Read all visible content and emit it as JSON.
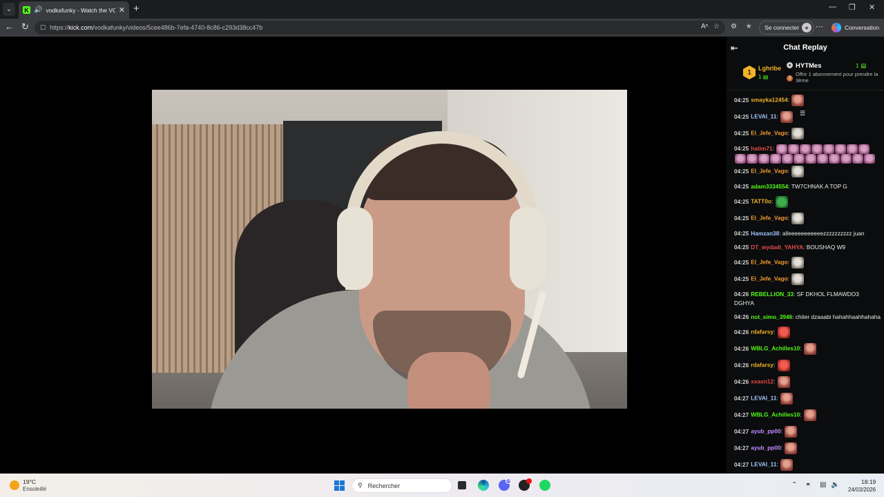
{
  "browser": {
    "tab_title": "vodkafunky - Watch the VOD",
    "url_prefix": "https://",
    "url_domain": "kick.com",
    "url_path": "/vodkafunky/videos/5cee486b-7efa-4740-8c86-c293d38cc47b",
    "sign_in_label": "Se connecter",
    "copilot_label": "Conversation"
  },
  "chat": {
    "title": "Chat Replay",
    "leader": {
      "rank": "1",
      "name": "Lghribe",
      "count": "1"
    },
    "gifter": {
      "name": "HYTMes",
      "count": "1",
      "third_rank": "3",
      "note": "Offrir 1 abonnement pour prendre la 3ème"
    },
    "messages": [
      {
        "time": "04:25",
        "user": "smayka12454",
        "color": "#f0b429",
        "text": "",
        "emotes": [
          "brown"
        ]
      },
      {
        "time": "04:25",
        "user": "LEVAI_11",
        "color": "#9ec7ff",
        "text": "",
        "emotes": [
          "brown"
        ]
      },
      {
        "time": "04:25",
        "user": "El_Jefe_Vago",
        "color": "#f39c33",
        "text": "",
        "emotes": [
          "gray"
        ]
      },
      {
        "time": "04:25",
        "user": "hatim71",
        "color": "#e64b4b",
        "text": "",
        "emotes": [
          "pink",
          "pink",
          "pink",
          "pink",
          "pink",
          "pink",
          "pink",
          "pink",
          "pink",
          "pink",
          "pink",
          "pink",
          "pink",
          "pink",
          "pink",
          "pink",
          "pink",
          "pink",
          "pink",
          "pink"
        ]
      },
      {
        "time": "04:25",
        "user": "El_Jefe_Vago",
        "color": "#f39c33",
        "text": "",
        "emotes": [
          "gray"
        ]
      },
      {
        "time": "04:25",
        "user": "adam3334554",
        "color": "#53fc18",
        "text": "TW7CHNAK A TOP G",
        "emotes": []
      },
      {
        "time": "04:25",
        "user": "TATT0o",
        "color": "#f0b429",
        "text": "",
        "emotes": [
          "frog"
        ]
      },
      {
        "time": "04:25",
        "user": "El_Jefe_Vago",
        "color": "#f39c33",
        "text": "",
        "emotes": [
          "gray"
        ]
      },
      {
        "time": "04:25",
        "user": "Hamzan38",
        "color": "#9ec7ff",
        "text": "alleeeeeeeeeeezzzzzzzzzz juan",
        "emotes": []
      },
      {
        "time": "04:25",
        "user": "DT_wydadi_YAHYA",
        "color": "#e64b4b",
        "text": "BOUSHAQ W9",
        "emotes": []
      },
      {
        "time": "04:25",
        "user": "El_Jefe_Vago",
        "color": "#f39c33",
        "text": "",
        "emotes": [
          "gray"
        ]
      },
      {
        "time": "04:25",
        "user": "El_Jefe_Vago",
        "color": "#f39c33",
        "text": "",
        "emotes": [
          "gray"
        ]
      },
      {
        "time": "04:26",
        "user": "REBELLION_33",
        "color": "#53fc18",
        "text": "SF DKHOL FLMAWDO3 DGHYA",
        "emotes": []
      },
      {
        "time": "04:26",
        "user": "not_simo_3946",
        "color": "#53fc18",
        "text": "chiter dzaaabi hahahhaahhahaha",
        "emotes": []
      },
      {
        "time": "04:26",
        "user": "rdafarsy",
        "color": "#f0b429",
        "text": "",
        "emotes": [
          "red"
        ]
      },
      {
        "time": "04:26",
        "user": "WBLG_Achilles10",
        "color": "#53fc18",
        "text": "",
        "emotes": [
          "brown"
        ]
      },
      {
        "time": "04:26",
        "user": "rdafarsy",
        "color": "#f0b429",
        "text": "",
        "emotes": [
          "red"
        ]
      },
      {
        "time": "04:26",
        "user": "xxasn12",
        "color": "#e64b4b",
        "text": "",
        "emotes": [
          "brown"
        ]
      },
      {
        "time": "04:27",
        "user": "LEVAI_11",
        "color": "#9ec7ff",
        "text": "",
        "emotes": [
          "brown"
        ]
      },
      {
        "time": "04:27",
        "user": "WBLG_Achilles10",
        "color": "#53fc18",
        "text": "",
        "emotes": [
          "brown"
        ]
      },
      {
        "time": "04:27",
        "user": "ayub_pp00",
        "color": "#c08bff",
        "text": "",
        "emotes": [
          "brown"
        ]
      },
      {
        "time": "04:27",
        "user": "ayub_pp00",
        "color": "#c08bff",
        "text": "",
        "emotes": [
          "brown"
        ]
      },
      {
        "time": "04:27",
        "user": "LEVAI_11",
        "color": "#9ec7ff",
        "text": "",
        "emotes": [
          "brown"
        ]
      }
    ]
  },
  "taskbar": {
    "temperature": "19°C",
    "weather": "Ensoleillé",
    "search_placeholder": "Rechercher",
    "time": "18:19",
    "date": "24/03/2026",
    "discord_badge": "9+"
  }
}
